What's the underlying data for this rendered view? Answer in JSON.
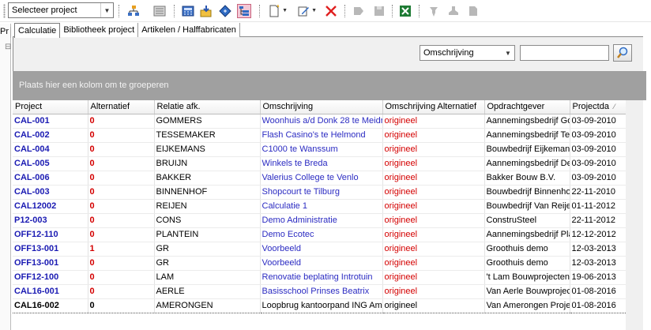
{
  "toolbar": {
    "project_select": {
      "value": "Selecteer project"
    },
    "icons": [
      "hierarchy-icon",
      "list-view-icon",
      "calculator-icon",
      "import-icon",
      "diamond-nav-icon",
      "tree-view-icon",
      "new-document-icon",
      "edit-document-icon",
      "delete-icon",
      "tag-icon",
      "save-icon",
      "excel-icon",
      "pin-icon",
      "stamp-icon",
      "page-icon"
    ],
    "colors": {
      "active_bg": "#f3c9d7",
      "delete": "#e02020",
      "excel": "#1e7b34"
    }
  },
  "background_window": {
    "tab_fragment": "Pr",
    "minus_fragment": "⊟"
  },
  "tabs": [
    {
      "label": "Calculatie",
      "selected": true
    },
    {
      "label": "Bibliotheek project",
      "selected": false
    },
    {
      "label": "Artikelen / Halffabricaten",
      "selected": false
    }
  ],
  "search": {
    "field_value": "Omschrijving",
    "input_value": "",
    "button_icon": "magnifier-icon"
  },
  "group_area": {
    "placeholder": "Plaats hier een kolom om te groeperen"
  },
  "grid": {
    "columns": [
      "Project",
      "Alternatief",
      "Relatie afk.",
      "Omschrijving",
      "Omschrijving Alternatief",
      "Opdrachtgever",
      "Projectda"
    ],
    "sort_indicator": "⁄",
    "rows": [
      [
        "CAL-001",
        "0",
        "GOMMERS",
        "Woonhuis a/d Donk 28 te Meidre",
        "origineel",
        "Aannemingsbedrijf Go",
        "03-09-2010"
      ],
      [
        "CAL-002",
        "0",
        "TESSEMAKER",
        "Flash Casino's te Helmond",
        "origineel",
        "Aannemingsbedrijf Te",
        "03-09-2010"
      ],
      [
        "CAL-004",
        "0",
        "EIJKEMANS",
        "C1000 te Wanssum",
        "origineel",
        "Bouwbedrijf Eijkemans",
        "03-09-2010"
      ],
      [
        "CAL-005",
        "0",
        "BRUIJN",
        "Winkels te Breda",
        "origineel",
        "Aannemingsbedrijf De",
        "03-09-2010"
      ],
      [
        "CAL-006",
        "0",
        "BAKKER",
        "Valerius College te Venlo",
        "origineel",
        "Bakker Bouw B.V.",
        "03-09-2010"
      ],
      [
        "CAL-003",
        "0",
        "BINNENHOF",
        "Shopcourt te Tilburg",
        "origineel",
        "Bouwbedrijf Binnenho",
        "22-11-2010"
      ],
      [
        "CAL12002",
        "0",
        "REIJEN",
        "Calculatie 1",
        "origineel",
        "Bouwbedrijf Van Reije",
        "01-11-2012"
      ],
      [
        "P12-003",
        "0",
        "CONS",
        "Demo Administratie",
        "origineel",
        "ConstruSteel",
        "22-11-2012"
      ],
      [
        "OFF12-110",
        "0",
        "PLANTEIN",
        "Demo Ecotec",
        "origineel",
        "Aannemingsbedrijf Pla",
        "12-12-2012"
      ],
      [
        "OFF13-001",
        "1",
        "GR",
        "Voorbeeld",
        "origineel",
        "Groothuis demo",
        "12-03-2013"
      ],
      [
        "OFF13-001",
        "0",
        "GR",
        "Voorbeeld",
        "origineel",
        "Groothuis demo",
        "12-03-2013"
      ],
      [
        "OFF12-100",
        "0",
        "LAM",
        "Renovatie beplating Introtuin",
        "origineel",
        "'t Lam Bouwprojecten",
        "19-06-2013"
      ],
      [
        "CAL16-001",
        "0",
        "AERLE",
        "Basisschool Prinses Beatrix",
        "origineel",
        "Van Aerle Bouwprojec",
        "01-08-2016"
      ],
      [
        "CAL16-002",
        "0",
        "AMERONGEN",
        "Loopbrug kantoorpand ING Ams",
        "origineel",
        "Van Amerongen Proje",
        "01-08-2016"
      ]
    ],
    "selected_row": 13,
    "colors": {
      "project": "#1b1bb3",
      "alternatief": "#d40000",
      "omschrijving": "#2b2bc2",
      "omschrijving_alt": "#d40000"
    }
  }
}
